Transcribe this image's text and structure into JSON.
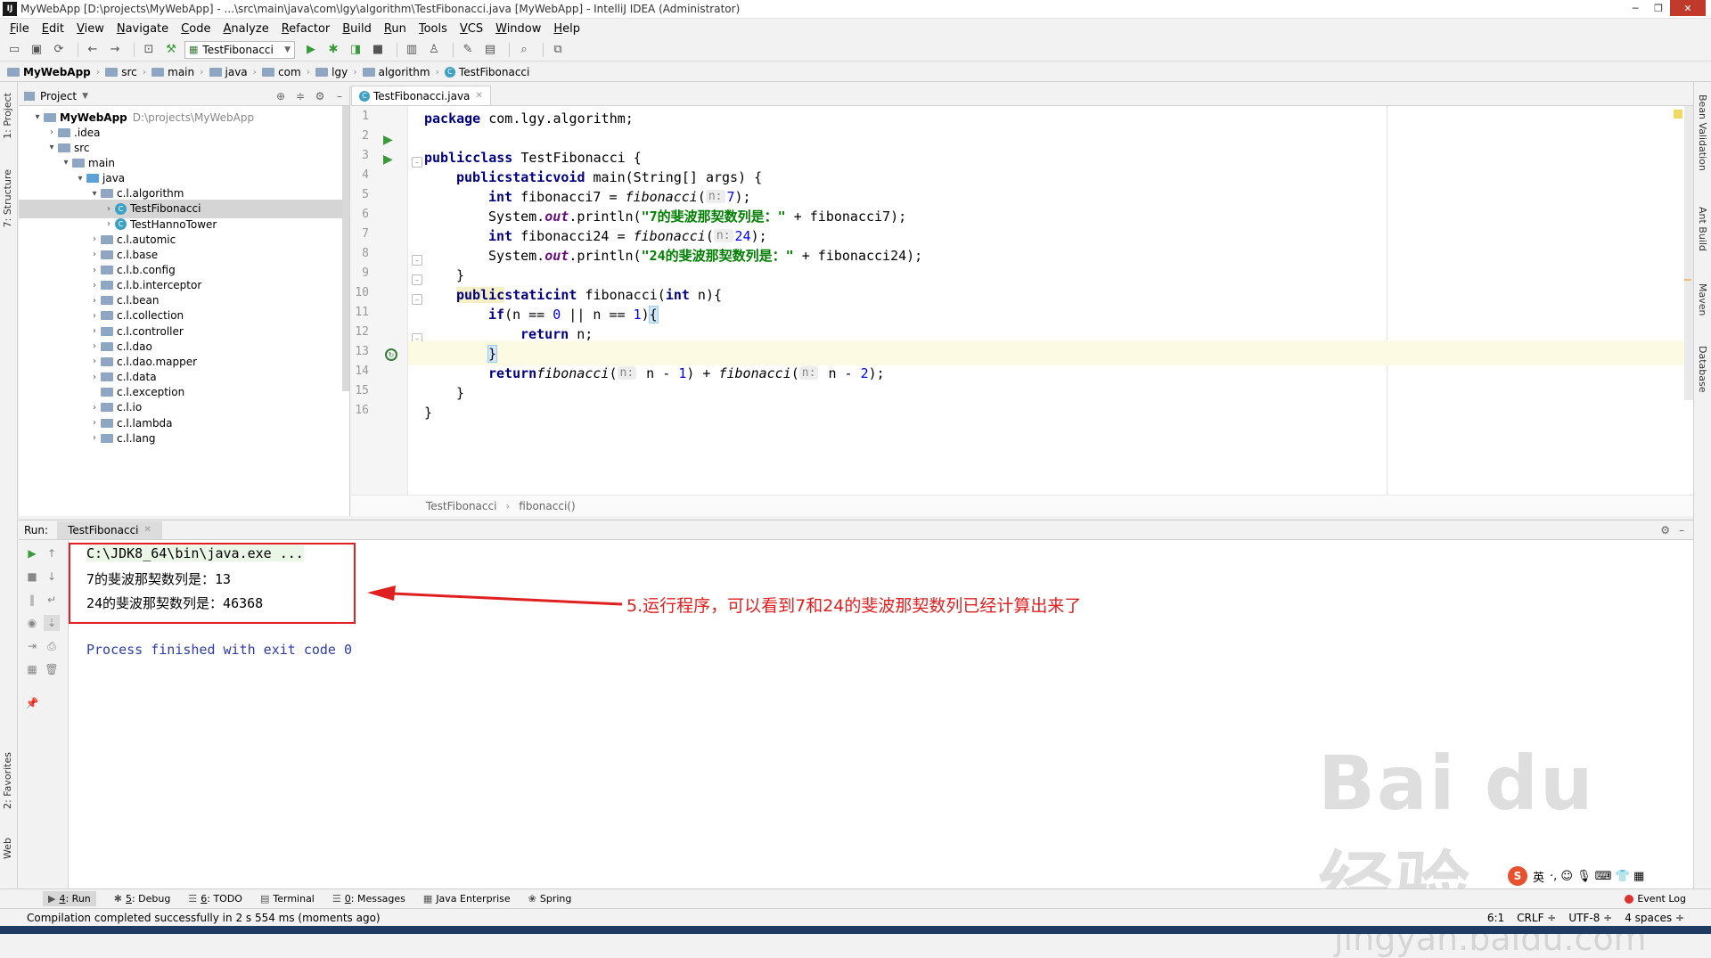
{
  "window": {
    "title": "MyWebApp [D:\\projects\\MyWebApp] - ...\\src\\main\\java\\com\\lgy\\algorithm\\TestFibonacci.java [MyWebApp] - IntelliJ IDEA (Administrator)",
    "app_icon": "IJ",
    "minimize": "─",
    "maximize": "❐",
    "close": "✕"
  },
  "menu": [
    "File",
    "Edit",
    "View",
    "Navigate",
    "Code",
    "Analyze",
    "Refactor",
    "Build",
    "Run",
    "Tools",
    "VCS",
    "Window",
    "Help"
  ],
  "toolbar": {
    "run_config": "TestFibonacci",
    "icons": [
      "open-folder-icon",
      "save-icon",
      "sync-icon",
      "back-icon",
      "forward-icon",
      "build-icon",
      "hammer-icon",
      "run-icon",
      "debug-icon",
      "coverage-icon",
      "stop-icon",
      "project-structure-icon",
      "sdk-icon",
      "settings-icon",
      "project-settings-icon",
      "search-icon",
      "vcs-icon"
    ]
  },
  "breadcrumb": [
    "MyWebApp",
    "src",
    "main",
    "java",
    "com",
    "lgy",
    "algorithm",
    "TestFibonacci"
  ],
  "left_strip": {
    "project": "1: Project",
    "structure": "7: Structure",
    "favorites": "2: Favorites",
    "web": "Web"
  },
  "right_strip": {
    "bean": "Bean Validation",
    "ant": "Ant Build",
    "maven": "Maven",
    "database": "Database"
  },
  "project_panel": {
    "title": "Project",
    "tree": [
      {
        "label": "MyWebApp",
        "path": "D:\\projects\\MyWebApp",
        "depth": 0,
        "open": true,
        "kind": "module"
      },
      {
        "label": ".idea",
        "depth": 1,
        "open": false,
        "kind": "folder"
      },
      {
        "label": "src",
        "depth": 1,
        "open": true,
        "kind": "folder"
      },
      {
        "label": "main",
        "depth": 2,
        "open": true,
        "kind": "folder"
      },
      {
        "label": "java",
        "depth": 3,
        "open": true,
        "kind": "java"
      },
      {
        "label": "c.l.algorithm",
        "depth": 4,
        "open": true,
        "kind": "folder"
      },
      {
        "label": "TestFibonacci",
        "depth": 5,
        "open": false,
        "kind": "class",
        "selected": true
      },
      {
        "label": "TestHannoTower",
        "depth": 5,
        "open": false,
        "kind": "class"
      },
      {
        "label": "c.l.automic",
        "depth": 4,
        "open": false,
        "kind": "folder"
      },
      {
        "label": "c.l.base",
        "depth": 4,
        "open": false,
        "kind": "folder"
      },
      {
        "label": "c.l.b.config",
        "depth": 4,
        "open": false,
        "kind": "folder"
      },
      {
        "label": "c.l.b.interceptor",
        "depth": 4,
        "open": false,
        "kind": "folder"
      },
      {
        "label": "c.l.bean",
        "depth": 4,
        "open": false,
        "kind": "folder"
      },
      {
        "label": "c.l.collection",
        "depth": 4,
        "open": false,
        "kind": "folder"
      },
      {
        "label": "c.l.controller",
        "depth": 4,
        "open": false,
        "kind": "folder"
      },
      {
        "label": "c.l.dao",
        "depth": 4,
        "open": false,
        "kind": "folder"
      },
      {
        "label": "c.l.dao.mapper",
        "depth": 4,
        "open": false,
        "kind": "folder"
      },
      {
        "label": "c.l.data",
        "depth": 4,
        "open": false,
        "kind": "folder"
      },
      {
        "label": "c.l.exception",
        "depth": 4,
        "open": null,
        "kind": "folder"
      },
      {
        "label": "c.l.io",
        "depth": 4,
        "open": false,
        "kind": "folder"
      },
      {
        "label": "c.l.lambda",
        "depth": 4,
        "open": false,
        "kind": "folder"
      },
      {
        "label": "c.l.lang",
        "depth": 4,
        "open": false,
        "kind": "folder"
      }
    ]
  },
  "editor": {
    "tab": "TestFibonacci.java",
    "line_numbers": [
      "1",
      "2",
      "3",
      "4",
      "5",
      "6",
      "7",
      "8",
      "9",
      "10",
      "11",
      "12",
      "13",
      "14",
      "15",
      "16"
    ],
    "line1": {
      "kw": "package",
      "rest": " com.lgy.algorithm;"
    },
    "line3": {
      "kw1": "public",
      "kw2": "class",
      "rest": " TestFibonacci {"
    },
    "line4": {
      "kw1": "public",
      "kw2": "static",
      "kw3": "void",
      "rest": " main(String[] args) {"
    },
    "line5": {
      "kw": "int",
      "a": " fibonacci7 = ",
      "call": "fibonacci",
      "open": "(",
      "hint": "n:",
      "num": "7",
      "close": ");"
    },
    "line6": {
      "a": "System.",
      "field": "out",
      "b": ".println(",
      "str": "\"7的斐波那契数列是：\"",
      "c": " + fibonacci7);"
    },
    "line7": {
      "kw": "int",
      "a": " fibonacci24 = ",
      "call": "fibonacci",
      "open": "(",
      "hint": "n:",
      "num": "24",
      "close": ");"
    },
    "line8": {
      "a": "System.",
      "field": "out",
      "b": ".println(",
      "str": "\"24的斐波那契数列是：\"",
      "c": " + fibonacci24);"
    },
    "line9": "}",
    "line10": {
      "kw1": "public",
      "kw2": "static",
      "kw3": "int",
      "a": " fibonacci(",
      "kw4": "int",
      "b": " n){"
    },
    "line11": {
      "kw": "if",
      "a": "(n == ",
      "num1": "0",
      "b": " || n == ",
      "num2": "1",
      "c": ")",
      "brace": "{"
    },
    "line12": {
      "kw": "return",
      "rest": " n;"
    },
    "line13": "}",
    "line14": {
      "kw": "return",
      "call1": "fibonacci",
      "open1": "(",
      "hint1": "n:",
      "a": " n - ",
      "num1": "1",
      "b": ") + ",
      "call2": "fibonacci",
      "open2": "(",
      "hint2": "n:",
      "c": " n - ",
      "num2": "2",
      "d": ");"
    },
    "line15": "}",
    "line16": "}",
    "crumbs": [
      "TestFibonacci",
      "fibonacci()"
    ]
  },
  "run_panel": {
    "label": "Run:",
    "tab": "TestFibonacci",
    "console": [
      "C:\\JDK8_64\\bin\\java.exe ...",
      "7的斐波那契数列是：13",
      "24的斐波那契数列是：46368",
      "",
      "Process finished with exit code 0"
    ],
    "annotation": "5.运行程序，可以看到7和24的斐波那契数列已经计算出来了",
    "annotation_color": "#e02020"
  },
  "bottom_tabs": [
    {
      "num": "4",
      "label": ": Run",
      "icon": "▶",
      "active": true
    },
    {
      "num": "5",
      "label": ": Debug",
      "icon": "✱"
    },
    {
      "num": "6",
      "label": ": TODO",
      "icon": "☰"
    },
    {
      "num": "",
      "label": "Terminal",
      "icon": "▤"
    },
    {
      "num": "0",
      "label": ": Messages",
      "icon": "☰"
    },
    {
      "num": "",
      "label": "Java Enterprise",
      "icon": "▦"
    },
    {
      "num": "",
      "label": "Spring",
      "icon": "❀"
    }
  ],
  "event_log": "Event Log",
  "status": {
    "message": "Compilation completed successfully in 2 s 554 ms (moments ago)",
    "position": "6:1",
    "line_sep": "CRLF ÷",
    "encoding": "UTF-8 ÷",
    "indent": "4 spaces ÷"
  },
  "watermark": {
    "brand": "Bai du 经验",
    "site": "jingyan.baidu.com"
  },
  "ime": {
    "logo": "S",
    "lang": "英",
    "icons": "·, ☺ 🎙 ⌨ 👕 ▦"
  }
}
